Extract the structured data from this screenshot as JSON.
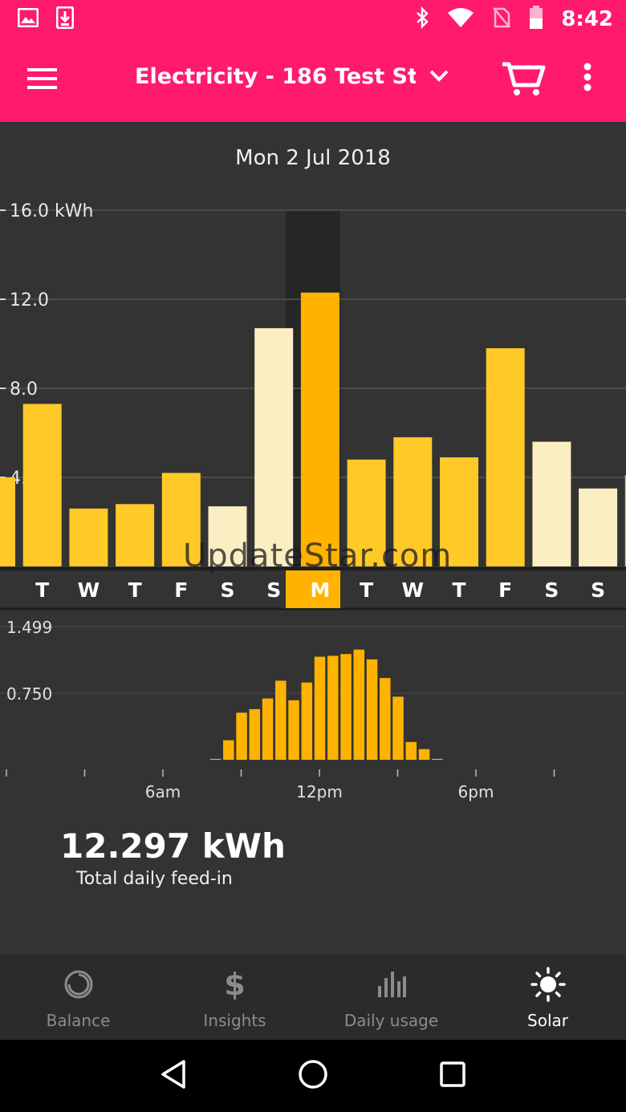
{
  "status_bar": {
    "time": "8:42"
  },
  "app_bar": {
    "title": "Electricity - 186 Test Stre..."
  },
  "date_label": "Mon 2 Jul 2018",
  "watermark": "UpdateStar.com",
  "colors": {
    "brand": "#ff1a6c",
    "bar_normal": "#ffc928",
    "bar_weekend": "#fbeec2",
    "bar_selected": "#ffb300",
    "background": "#333333"
  },
  "chart_data": [
    {
      "type": "bar",
      "title": "",
      "ylabel": "",
      "y_ticks": [
        "16.0 kWh",
        "12.0",
        "8.0",
        "4.0"
      ],
      "ylim": [
        0,
        16
      ],
      "grid": true,
      "categories": [
        "",
        "T",
        "W",
        "T",
        "F",
        "S",
        "S",
        "M",
        "T",
        "W",
        "T",
        "F",
        "S",
        "S",
        ""
      ],
      "values": [
        4.0,
        7.3,
        2.6,
        2.8,
        4.2,
        2.7,
        10.7,
        12.3,
        4.8,
        5.8,
        4.9,
        9.8,
        5.6,
        3.5,
        4.1
      ],
      "kind": [
        "normal",
        "normal",
        "normal",
        "normal",
        "normal",
        "weekend",
        "weekend",
        "selected",
        "normal",
        "normal",
        "normal",
        "normal",
        "weekend",
        "weekend",
        "normal"
      ],
      "selected_index": 7
    },
    {
      "type": "bar",
      "title": "",
      "y_ticks": [
        "1.499",
        "0.750"
      ],
      "ylim": [
        0,
        1.499
      ],
      "x_ticks": [
        "6am",
        "12pm",
        "6pm"
      ],
      "grid": true,
      "x_hours": [
        8.0,
        8.5,
        9.0,
        9.5,
        10.0,
        10.5,
        11.0,
        11.5,
        12.0,
        12.5,
        13.0,
        13.5,
        14.0,
        14.5,
        15.0,
        15.5,
        16.0,
        16.5
      ],
      "values": [
        0.01,
        0.22,
        0.53,
        0.57,
        0.69,
        0.89,
        0.67,
        0.87,
        1.16,
        1.17,
        1.19,
        1.24,
        1.13,
        0.92,
        0.71,
        0.2,
        0.12,
        0.01
      ]
    }
  ],
  "summary": {
    "value": "12.297 kWh",
    "label": "Total daily feed-in"
  },
  "bottom_nav": [
    {
      "label": "Balance",
      "icon": "balance-ring-icon",
      "active": false
    },
    {
      "label": "Insights",
      "icon": "dollar-icon",
      "active": false
    },
    {
      "label": "Daily usage",
      "icon": "bar-chart-icon",
      "active": false
    },
    {
      "label": "Solar",
      "icon": "sun-icon",
      "active": true
    }
  ]
}
